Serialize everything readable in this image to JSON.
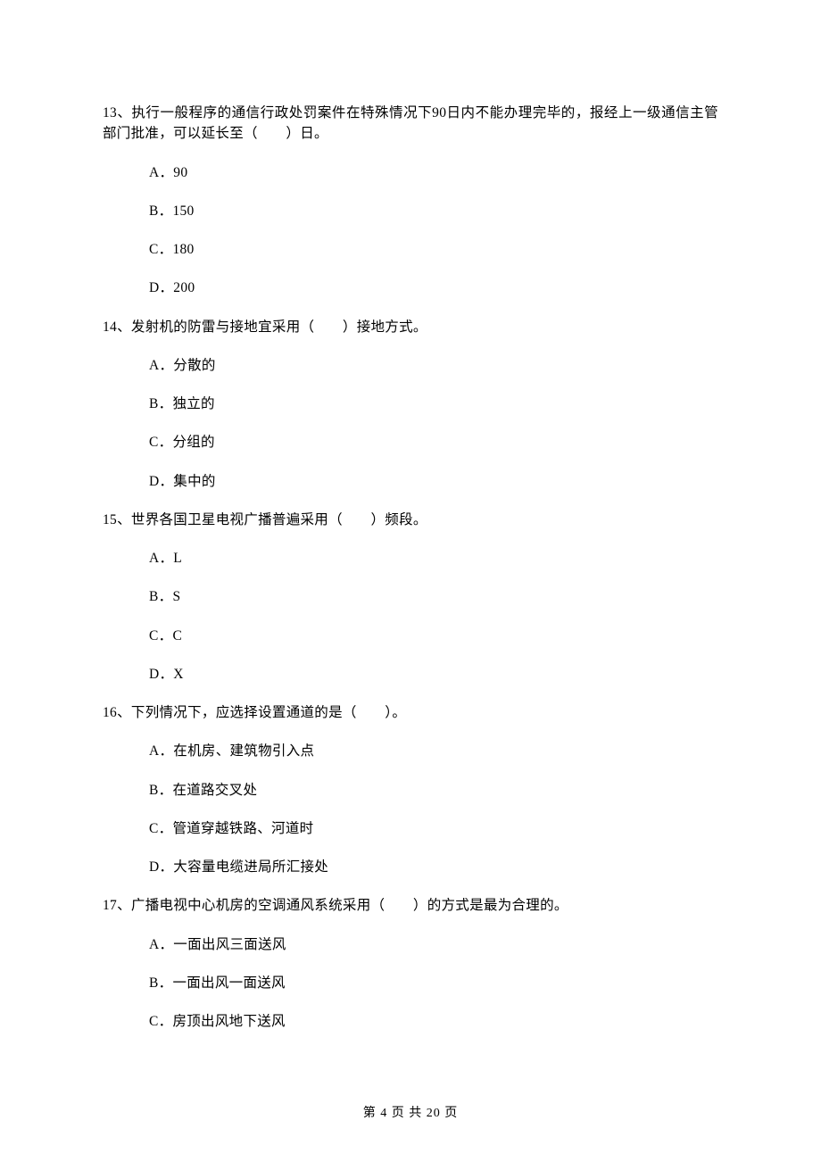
{
  "questions": [
    {
      "text": "13、执行一般程序的通信行政处罚案件在特殊情况下90日内不能办理完毕的，报经上一级通信主管部门批准，可以延长至（　　）日。",
      "options": [
        "A．90",
        "B．150",
        "C．180",
        "D．200"
      ]
    },
    {
      "text": "14、发射机的防雷与接地宜采用（　　）接地方式。",
      "options": [
        "A．分散的",
        "B．独立的",
        "C．分组的",
        "D．集中的"
      ]
    },
    {
      "text": "15、世界各国卫星电视广播普遍采用（　　）频段。",
      "options": [
        "A．L",
        "B．S",
        "C．C",
        "D．X"
      ]
    },
    {
      "text": "16、下列情况下，应选择设置通道的是（　　）。",
      "options": [
        "A．在机房、建筑物引入点",
        "B．在道路交叉处",
        "C．管道穿越铁路、河道时",
        "D．大容量电缆进局所汇接处"
      ]
    },
    {
      "text": "17、广播电视中心机房的空调通风系统采用（　　）的方式是最为合理的。",
      "options": [
        "A．一面出风三面送风",
        "B．一面出风一面送风",
        "C．房顶出风地下送风"
      ]
    }
  ],
  "footer": "第 4 页 共 20 页"
}
